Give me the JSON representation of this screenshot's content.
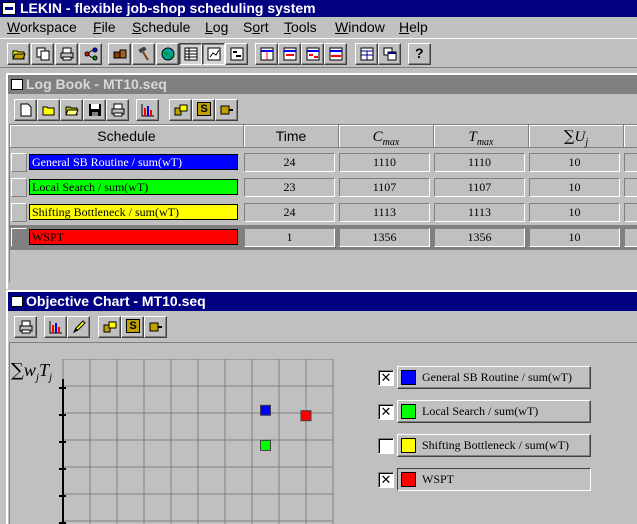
{
  "app": {
    "title": "LEKIN - flexible job-shop scheduling system"
  },
  "menu": [
    {
      "key": "W",
      "rest": "orkspace"
    },
    {
      "key": "F",
      "rest": "ile"
    },
    {
      "key": "S",
      "rest": "chedule"
    },
    {
      "key": "L",
      "rest": "og"
    },
    {
      "key": "S",
      "rest": "ort",
      "pre": "S",
      "key2": "o",
      "rest2": "rt"
    },
    {
      "key": "T",
      "rest": "ools"
    },
    {
      "key": "W",
      "rest": "indow"
    },
    {
      "key": "H",
      "rest": "elp"
    }
  ],
  "main_toolbar": {
    "icons": [
      "open-icon",
      "copy-icon",
      "print-icon",
      "network-icon",
      "machines-icon",
      "hammer-icon",
      "globe-icon",
      "table-icon",
      "chart-icon",
      "gantt-icon",
      "gantt-machine-icon",
      "gantt-job-icon",
      "gantt-split-icon",
      "grid-icon",
      "windows-icon",
      "help-icon"
    ],
    "help_label": "?"
  },
  "logbook": {
    "title": "Log Book - MT10.seq",
    "toolbar_icons": [
      "new-icon",
      "open-icon",
      "folder-icon",
      "save-icon",
      "print-icon",
      "bar-chart-icon",
      "rules-icon",
      "s-icon",
      "plugin-icon"
    ],
    "s_label": "S",
    "columns": {
      "schedule": "Schedule",
      "time": "Time",
      "cmax_base": "C",
      "cmax_sub": "max",
      "tmax_base": "T",
      "tmax_sub": "max",
      "sum_sym": "∑",
      "sum_base": "U",
      "sum_sub": "j"
    },
    "rows": [
      {
        "name": "General SB Routine / sum(wT)",
        "color": "#0000ff",
        "text_color": "#ffffff",
        "time": "24",
        "cmax": "1110",
        "tmax": "1110",
        "sum_uj": "10",
        "selected": false
      },
      {
        "name": "Local Search / sum(wT)",
        "color": "#00ff00",
        "text_color": "#000000",
        "time": "23",
        "cmax": "1107",
        "tmax": "1107",
        "sum_uj": "10",
        "selected": false
      },
      {
        "name": "Shifting Bottleneck / sum(wT)",
        "color": "#ffff00",
        "text_color": "#000000",
        "time": "24",
        "cmax": "1113",
        "tmax": "1113",
        "sum_uj": "10",
        "selected": false
      },
      {
        "name": "WSPT",
        "color": "#ff0000",
        "text_color": "#000000",
        "time": "1",
        "cmax": "1356",
        "tmax": "1356",
        "sum_uj": "10",
        "selected": true
      }
    ]
  },
  "objective_chart": {
    "title": "Objective Chart - MT10.seq",
    "toolbar_icons": [
      "print-icon",
      "bar-chart-icon",
      "pencil-icon",
      "rules-icon",
      "s-icon",
      "plugin-icon"
    ],
    "s_label": "S",
    "legend": [
      {
        "label": "General SB Routine / sum(wT)",
        "color": "#0000ff",
        "checked": true,
        "check_mark": "✕"
      },
      {
        "label": "Local Search / sum(wT)",
        "color": "#00ff00",
        "checked": true,
        "check_mark": "✕"
      },
      {
        "label": "Shifting Bottleneck / sum(wT)",
        "color": "#ffff00",
        "checked": false,
        "check_mark": ""
      },
      {
        "label": "WSPT",
        "color": "#ff0000",
        "checked": true,
        "check_mark": "✕"
      }
    ]
  },
  "chart_data": {
    "type": "scatter",
    "ylabel_sym": "∑",
    "ylabel_base": "w",
    "ylabel_sub1": "j",
    "ylabel_base2": "T",
    "ylabel_sub2": "j",
    "grid": true,
    "grid_cols": 10,
    "grid_rows": 7,
    "series": [
      {
        "name": "General SB Routine / sum(wT)",
        "color": "#0000ff",
        "x": 7.5,
        "y": 5.1
      },
      {
        "name": "Local Search / sum(wT)",
        "color": "#00ff00",
        "x": 7.5,
        "y": 3.8
      },
      {
        "name": "WSPT",
        "color": "#ff0000",
        "x": 9.0,
        "y": 4.9
      }
    ]
  }
}
